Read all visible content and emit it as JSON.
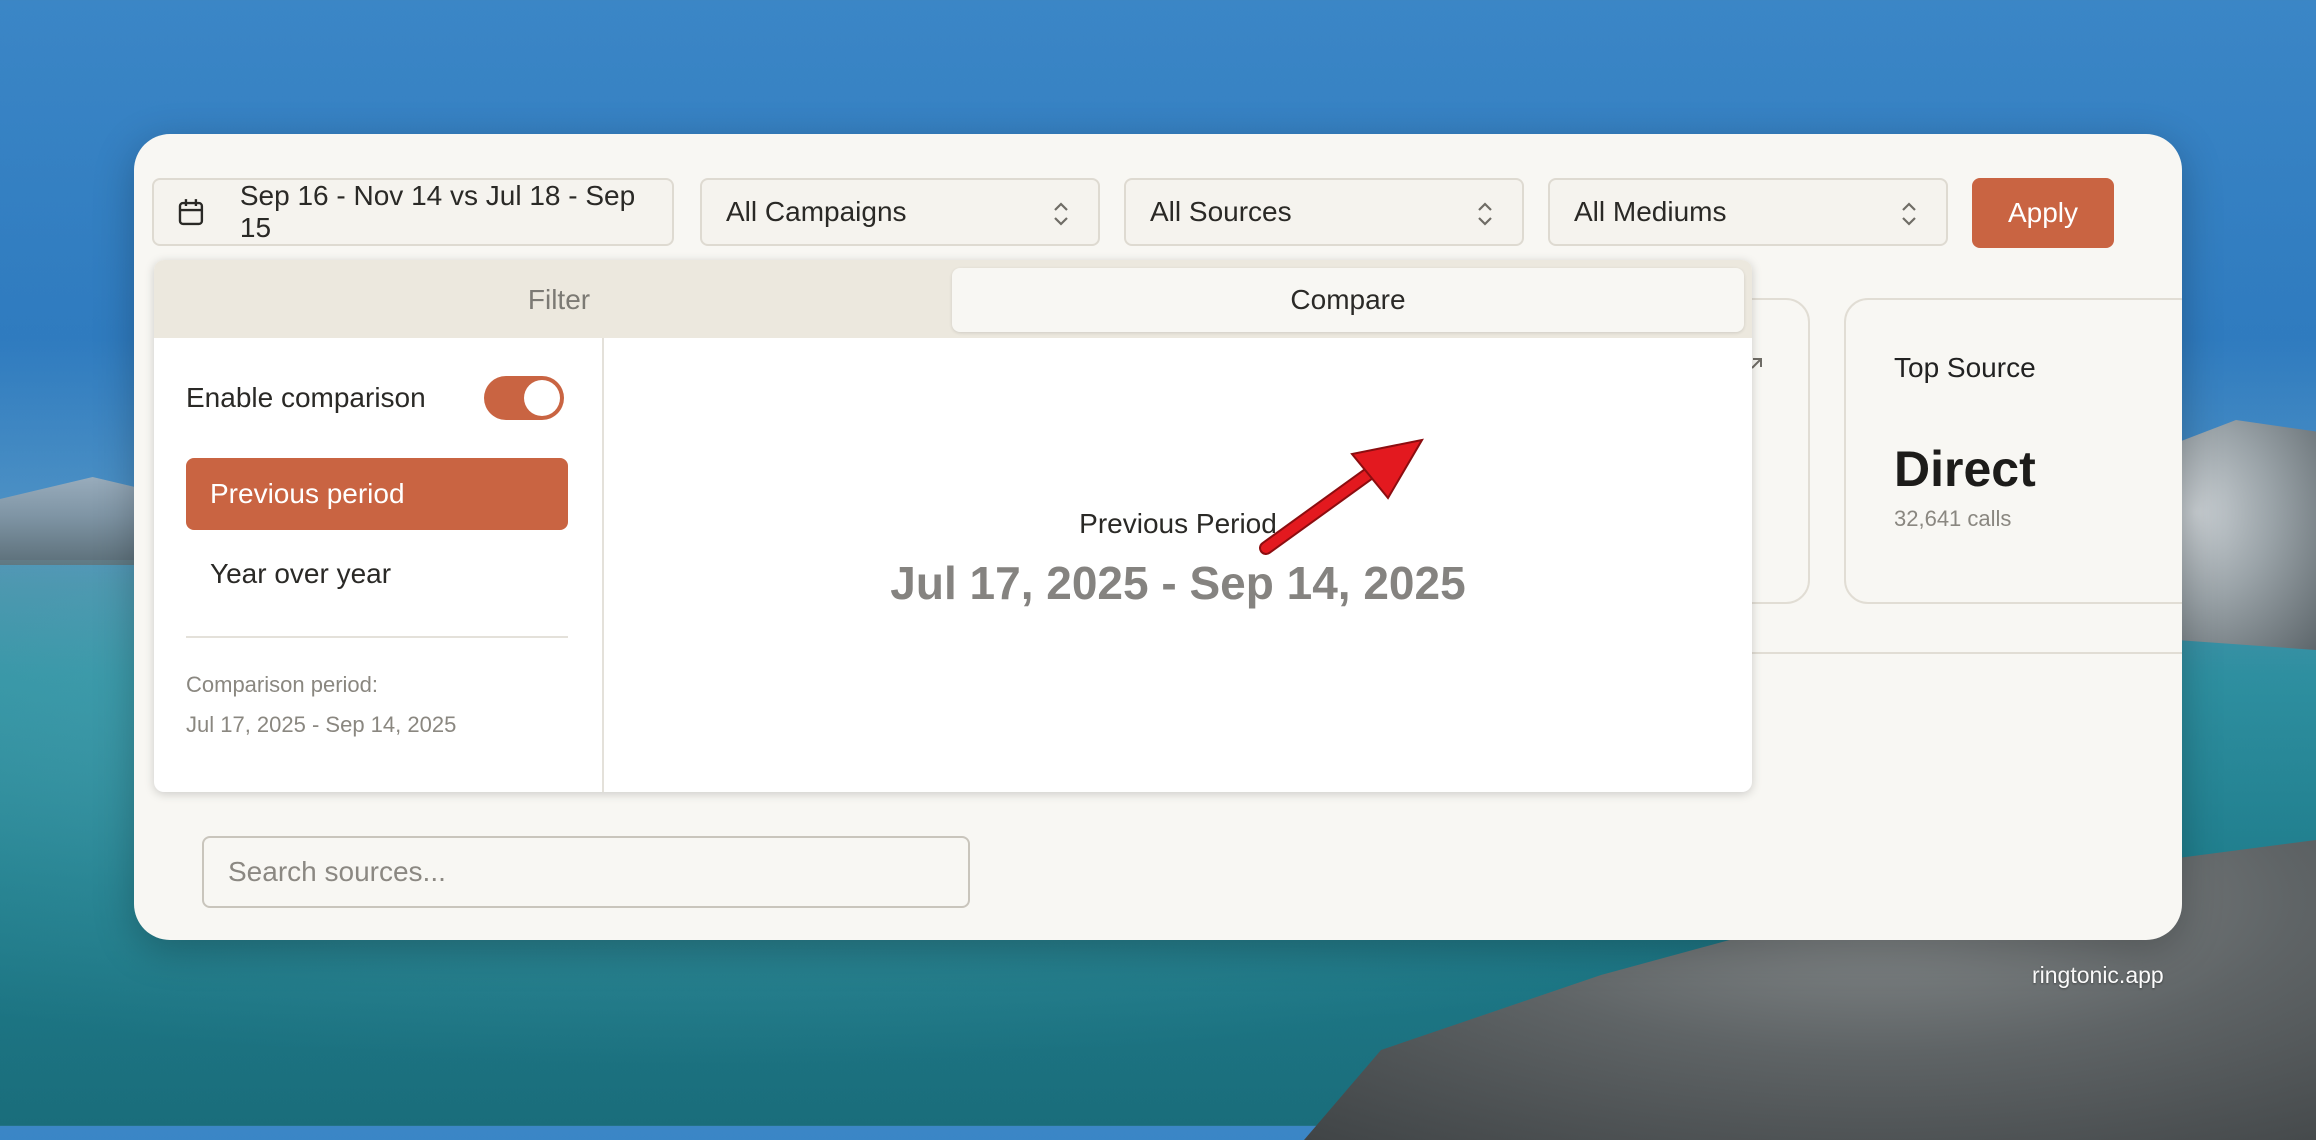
{
  "watermark": "ringtonic.app",
  "toolbar": {
    "date_range": "Sep 16 - Nov 14 vs Jul 18 - Sep 15",
    "campaigns": "All Campaigns",
    "sources": "All Sources",
    "mediums": "All Mediums",
    "apply_label": "Apply"
  },
  "popover": {
    "tabs": [
      {
        "label": "Filter",
        "active": false
      },
      {
        "label": "Compare",
        "active": true
      }
    ],
    "enable_label": "Enable comparison",
    "enable_on": true,
    "options": [
      {
        "label": "Previous period",
        "selected": true
      },
      {
        "label": "Year over year",
        "selected": false
      }
    ],
    "comparison_label": "Comparison period:",
    "comparison_value": "Jul 17, 2025 - Sep 14, 2025",
    "preview_label": "Previous Period",
    "preview_range": "Jul 17, 2025 - Sep 14, 2025"
  },
  "cards": {
    "top_source": {
      "title": "Top Source",
      "value": "Direct",
      "sub": "32,641 calls"
    }
  },
  "search": {
    "placeholder": "Search sources..."
  },
  "colors": {
    "accent": "#c96442",
    "window_bg": "#f8f7f3",
    "annotation_arrow": "#e3191f"
  },
  "icons": {
    "date": "calendar-icon",
    "select": "chevron-up-down-icon",
    "annotation": "red-arrow-icon"
  }
}
